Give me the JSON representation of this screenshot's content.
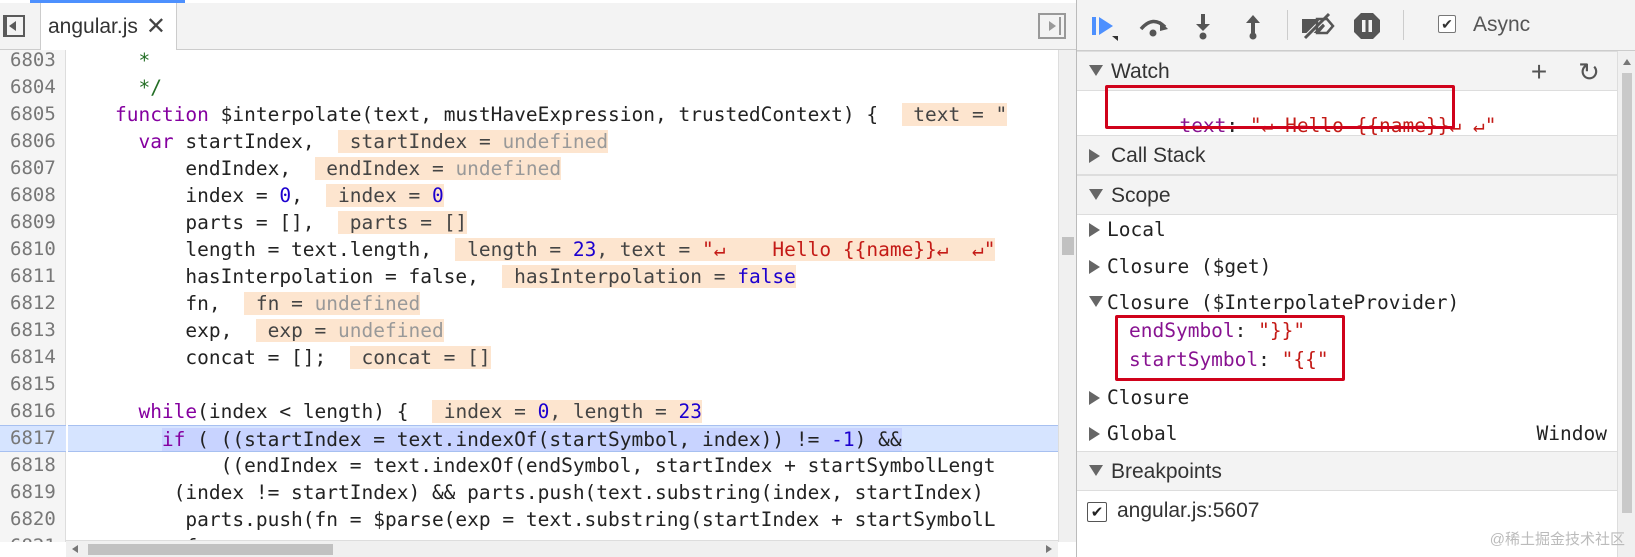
{
  "editor": {
    "tab_name": "angular.js",
    "close_glyph": "✕",
    "lines": [
      {
        "n": "6803",
        "html": "      <span class=\"cm\">*</span>"
      },
      {
        "n": "6804",
        "html": "      <span class=\"cm\">*/</span>"
      },
      {
        "n": "6805",
        "html": "    <span class=\"kwb\">function</span> $interpolate(text, mustHaveExpression, trustedContext) {  <span class=\"inl\"> text = \"</span>"
      },
      {
        "n": "6806",
        "html": "      <span class=\"kwb\">var</span> startIndex,  <span class=\"inl\"> startIndex = <span class=\"undef\">undefined</span></span>"
      },
      {
        "n": "6807",
        "html": "          endIndex,  <span class=\"inl\"> endIndex = <span class=\"undef\">undefined</span></span>"
      },
      {
        "n": "6808",
        "html": "          index = <span class=\"num\">0</span>,  <span class=\"inl\"> index = <span class=\"numv\">0</span></span>"
      },
      {
        "n": "6809",
        "html": "          parts = [],  <span class=\"inl\"> parts = []</span>"
      },
      {
        "n": "6810",
        "html": "          length = text.length,  <span class=\"inl\"> length = <span class=\"numv\">23</span>, text = <span class=\"strv\">\"↵    Hello {{name}}↵  ↵\"</span></span>"
      },
      {
        "n": "6811",
        "html": "          hasInterpolation = false,  <span class=\"inl\"> hasInterpolation = <span class=\"boolv\">false</span></span>"
      },
      {
        "n": "6812",
        "html": "          fn,  <span class=\"inl\"> fn = <span class=\"undef\">undefined</span></span>"
      },
      {
        "n": "6813",
        "html": "          exp,  <span class=\"inl\"> exp = <span class=\"undef\">undefined</span></span>"
      },
      {
        "n": "6814",
        "html": "          concat = [];  <span class=\"inl\"> concat = []</span>"
      },
      {
        "n": "6815",
        "html": ""
      },
      {
        "n": "6816",
        "html": "      <span class=\"kwb\">while</span>(index &lt; length) {  <span class=\"inl\"> index = <span class=\"numv\">0</span>, length = <span class=\"numv\">23</span></span>"
      },
      {
        "n": "6817",
        "html": "        <span class=\"exec-hl\"><span class=\"kwb\">if</span> ( ((startIndex = text.indexOf(startSymbol, index)) != <span class=\"num\">-1</span>) &amp;&amp;</span>",
        "exec": true
      },
      {
        "n": "6818",
        "html": "             ((endIndex = text.indexOf(endSymbol, startIndex + startSymbolLengt"
      },
      {
        "n": "6819",
        "html": "         (index != startIndex) &amp;&amp; parts.push(text.substring(index, startIndex)"
      },
      {
        "n": "6820",
        "html": "          parts.push(fn = $parse(exp = text.substring(startIndex + startSymbolL"
      },
      {
        "n": "6821",
        "html": "          f"
      }
    ]
  },
  "debugger": {
    "async_label": "Async",
    "async_checked": "✔",
    "watch": {
      "title": "Watch",
      "add_glyph": "+",
      "refresh_glyph": "↻",
      "expr_key": "text",
      "expr_sep": ": ",
      "expr_value": "\"↵ Hello {{name}}↵ ↵\""
    },
    "call_stack": {
      "title": "Call Stack"
    },
    "scope": {
      "title": "Scope",
      "rows": [
        {
          "label": "Local",
          "value": ""
        },
        {
          "label": "Closure ($get)",
          "value": ""
        },
        {
          "label": "Closure ($InterpolateProvider)",
          "value": "",
          "expanded": true
        },
        {
          "label": "Closure",
          "value": ""
        },
        {
          "label": "Global",
          "value": "Window"
        }
      ],
      "props": [
        {
          "key": "endSymbol",
          "sep": ": ",
          "value": "\"}}\""
        },
        {
          "key": "startSymbol",
          "sep": ": ",
          "value": "\"{{\""
        }
      ]
    },
    "breakpoints": {
      "title": "Breakpoints",
      "items": [
        {
          "label": "angular.js:5607",
          "checked": "✔"
        }
      ]
    },
    "watermark": "@稀土掘金技术社区"
  },
  "colors": {
    "accent": "#4d90fe",
    "annotation_box": "#d0021b",
    "inline_value_bg": "#fde5cf",
    "exec_line_bg": "#d6e4ff"
  }
}
